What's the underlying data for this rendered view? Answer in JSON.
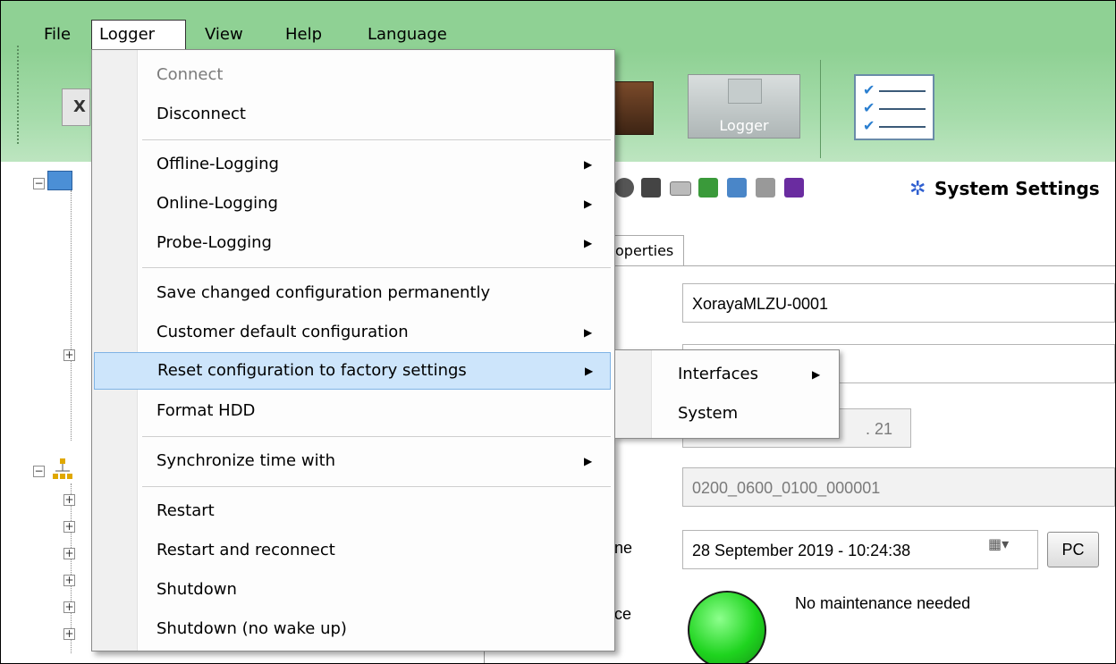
{
  "menubar": {
    "items": [
      "File",
      "Logger",
      "View",
      "Help",
      "Language"
    ]
  },
  "ribbon": {
    "left_button": "X",
    "logger_label": "Logger"
  },
  "logger_menu": {
    "connect": "Connect",
    "disconnect": "Disconnect",
    "offline_logging": "Offline-Logging",
    "online_logging": "Online-Logging",
    "probe_logging": "Probe-Logging",
    "save_config": "Save changed configuration permanently",
    "customer_default": "Customer default configuration",
    "reset_factory": "Reset configuration to factory settings",
    "format_hdd": "Format HDD",
    "sync_time": "Synchronize time with",
    "restart": "Restart",
    "restart_reconnect": "Restart and reconnect",
    "shutdown": "Shutdown",
    "shutdown_no_wake": "Shutdown (no wake up)"
  },
  "reset_submenu": {
    "interfaces": "Interfaces",
    "system": "System"
  },
  "toolbar2": {
    "system_settings": "System Settings"
  },
  "tabs": {
    "properties_partial": "operties"
  },
  "form": {
    "name_value": "XorayaMLZU-0001",
    "ip_partial": ". 21",
    "serial_value": "0200_0600_0100_000001",
    "time_label_partial": "ne",
    "time_value": "28 September 2019 - 10:24:38",
    "pc_button": "PC",
    "maintenance_label_partial": "ce",
    "maintenance_text": "No maintenance needed"
  },
  "colors": {
    "menubar_bg": "#8fd194",
    "highlight": "#cde5fb",
    "led_green": "#1fd41f"
  }
}
